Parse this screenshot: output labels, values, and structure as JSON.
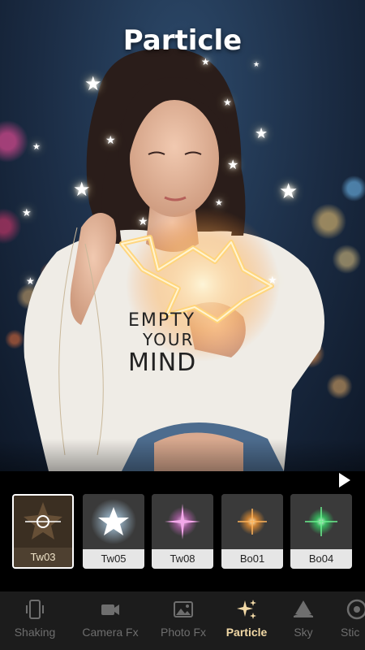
{
  "screen_title": "Particle",
  "photo": {
    "shirt_text_lines": [
      "EMPTY",
      "YOUR",
      "MIND"
    ]
  },
  "effects": [
    {
      "label": "Tw03",
      "selected": true,
      "glow_color": "#ffffff",
      "type": "crosshair"
    },
    {
      "label": "Tw05",
      "selected": false,
      "glow_color": "#bfe4ff",
      "type": "star"
    },
    {
      "label": "Tw08",
      "selected": false,
      "glow_color": "#e07ad8",
      "type": "twinkle"
    },
    {
      "label": "Bo01",
      "selected": false,
      "glow_color": "#ff9a2e",
      "type": "burst"
    },
    {
      "label": "Bo04",
      "selected": false,
      "glow_color": "#35e06a",
      "type": "burst"
    }
  ],
  "nav": {
    "items": [
      {
        "label": "Shaking",
        "icon": "shaking-icon",
        "active": false
      },
      {
        "label": "Camera Fx",
        "icon": "camera-icon",
        "active": false
      },
      {
        "label": "Photo Fx",
        "icon": "image-icon",
        "active": false
      },
      {
        "label": "Particle",
        "icon": "sparkle-icon",
        "active": true
      },
      {
        "label": "Sky",
        "icon": "sky-icon",
        "active": false
      },
      {
        "label": "Stic",
        "icon": "sticker-icon",
        "active": false
      }
    ]
  },
  "colors": {
    "accent": "#f2d9a6",
    "nav_background": "#1c1c1c",
    "tray_background": "#000000"
  }
}
